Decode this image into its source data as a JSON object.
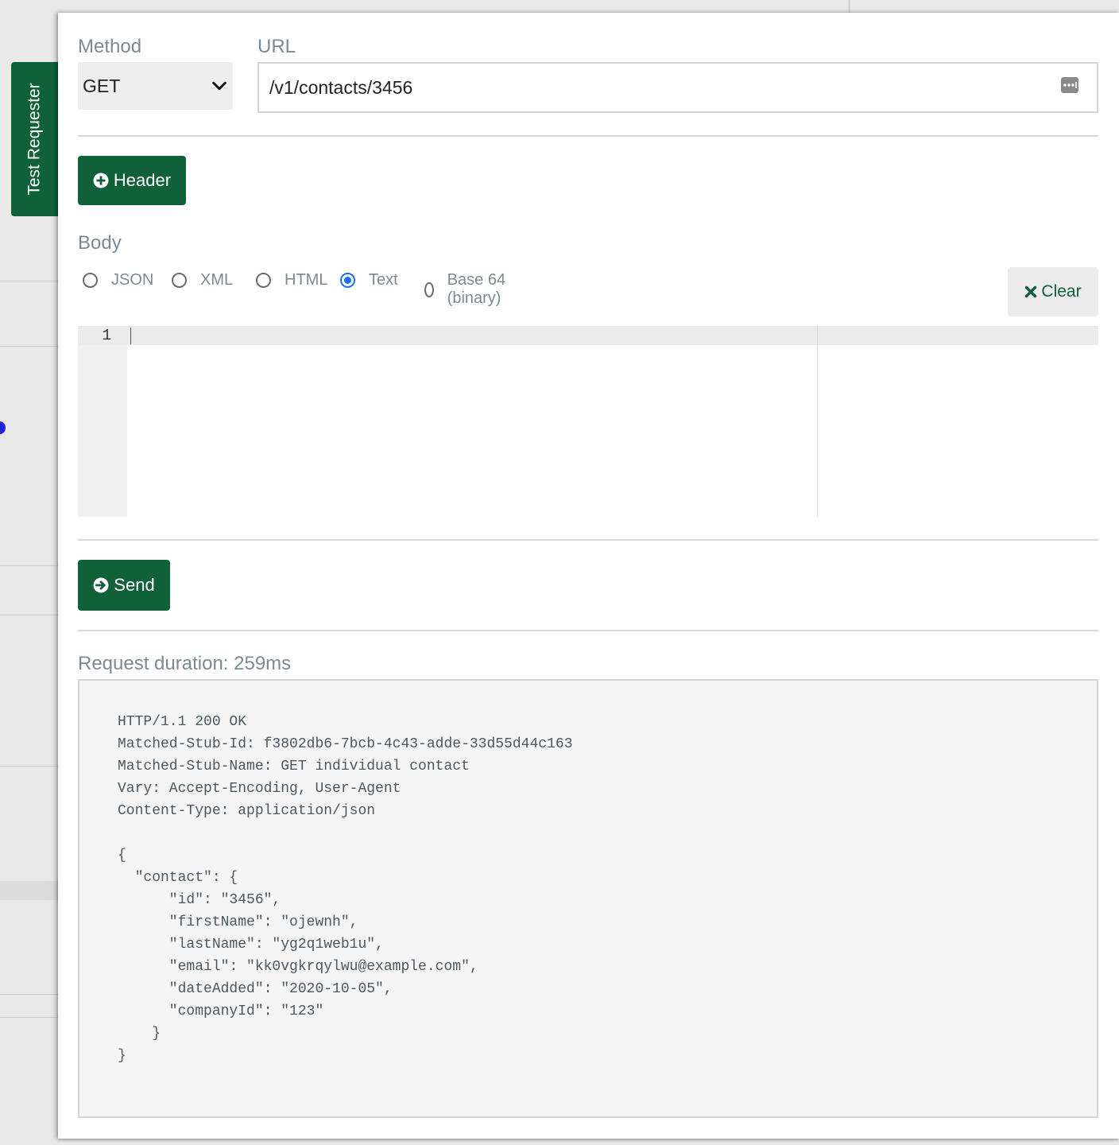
{
  "side_tab": {
    "label": "Test Requester"
  },
  "method": {
    "label": "Method",
    "selected": "GET"
  },
  "url": {
    "label": "URL",
    "value": "/v1/contacts/3456"
  },
  "header_button": {
    "label": "Header"
  },
  "body": {
    "label": "Body",
    "options": [
      "JSON",
      "XML",
      "HTML",
      "Text",
      "Base 64 (binary)"
    ],
    "selected": "Text",
    "clear_label": "Clear"
  },
  "editor": {
    "line_number": "1",
    "content": ""
  },
  "send_button": {
    "label": "Send"
  },
  "response": {
    "duration_label": "Request duration: 259ms",
    "text": "HTTP/1.1 200 OK\nMatched-Stub-Id: f3802db6-7bcb-4c43-adde-33d55d44c163\nMatched-Stub-Name: GET individual contact\nVary: Accept-Encoding, User-Agent\nContent-Type: application/json\n\n{\n  \"contact\": {\n      \"id\": \"3456\",\n      \"firstName\": \"ojewnh\",\n      \"lastName\": \"yg2q1web1u\",\n      \"email\": \"kk0vgkrqylwu@example.com\",\n      \"dateAdded\": \"2020-10-05\",\n      \"companyId\": \"123\"\n    }\n}"
  },
  "colors": {
    "brand_green": "#10603a",
    "radio_selected": "#1a73e8",
    "label_gray": "#7b8a92"
  },
  "icons": {
    "method_dropdown": "chevron-down-icon",
    "url_field": "ellipsis-box-icon",
    "header_button": "plus-circle-icon",
    "clear_button": "x-icon",
    "send_button": "arrow-circle-right-icon"
  }
}
